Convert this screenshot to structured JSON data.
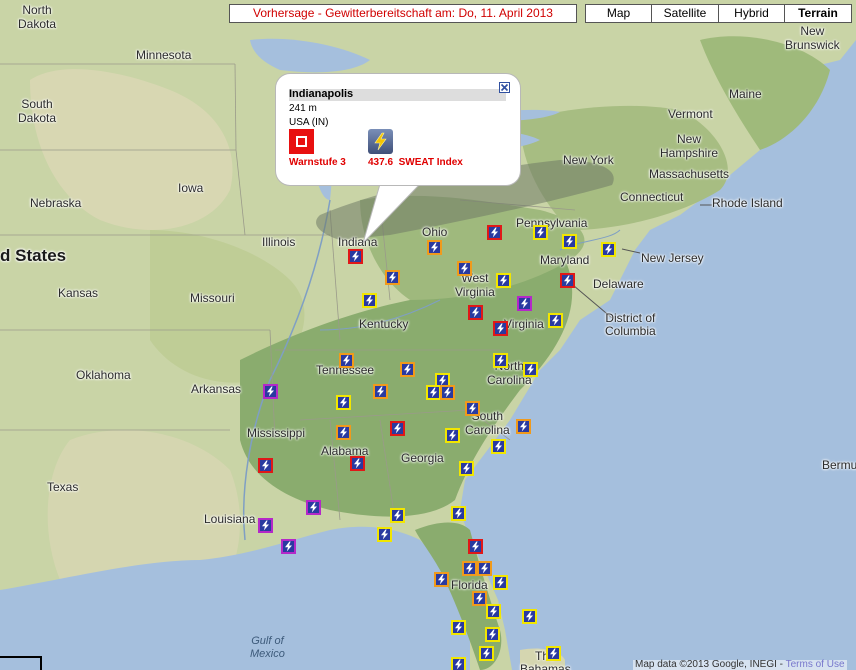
{
  "title": "Vorhersage - Gewitterbereitschaft am: Do, 11. April 2013",
  "map_types": [
    {
      "label": "Map",
      "active": false
    },
    {
      "label": "Satellite",
      "active": false
    },
    {
      "label": "Hybrid",
      "active": false
    },
    {
      "label": "Terrain",
      "active": true
    }
  ],
  "info_window": {
    "city": "Indianapolis",
    "elevation": "241 m",
    "country": "USA (IN)",
    "warn_label": "Warnstufe 3",
    "sweat_label": "437.6  SWEAT Index"
  },
  "places": {
    "north_dakota": "North\nDakota",
    "minnesota": "Minnesota",
    "south_dakota": "South\nDakota",
    "iowa": "Iowa",
    "nebraska": "Nebraska",
    "united_states": "d States",
    "kansas": "Kansas",
    "missouri": "Missouri",
    "illinois": "Illinois",
    "indiana": "Indiana",
    "ohio": "Ohio",
    "kentucky": "Kentucky",
    "west_virginia": "West\nVirginia",
    "virginia": "Virginia",
    "pennsylvania": "Pennsylvania",
    "maryland": "Maryland",
    "delaware": "Delaware",
    "new_jersey": "New Jersey",
    "district_of_columbia": "District of\nColumbia",
    "new_york": "New York",
    "connecticut": "Connecticut",
    "rhode_island": "Rhode Island",
    "massachusetts": "Massachusetts",
    "new_hampshire": "New\nHampshire",
    "vermont": "Vermont",
    "maine": "Maine",
    "new_brunswick": "New\nBrunswick",
    "oklahoma": "Oklahoma",
    "arkansas": "Arkansas",
    "tennessee": "Tennessee",
    "north_carolina": "North\nCarolina",
    "south_carolina": "South\nCarolina",
    "mississippi": "Mississippi",
    "alabama": "Alabama",
    "georgia": "Georgia",
    "texas": "Texas",
    "louisiana": "Louisiana",
    "florida": "Florida",
    "gulf_of_mexico": "Gulf of\nMexico",
    "bahamas": "The\nBahamas",
    "bermuda": "Bermu"
  },
  "marker_colors": {
    "y": "#f2e600",
    "o": "#f09a1c",
    "r": "#e01818",
    "m": "#b428c8"
  },
  "attribution": {
    "text": "Map data ©2013 Google, INEGI - ",
    "link": "Terms of Use"
  }
}
